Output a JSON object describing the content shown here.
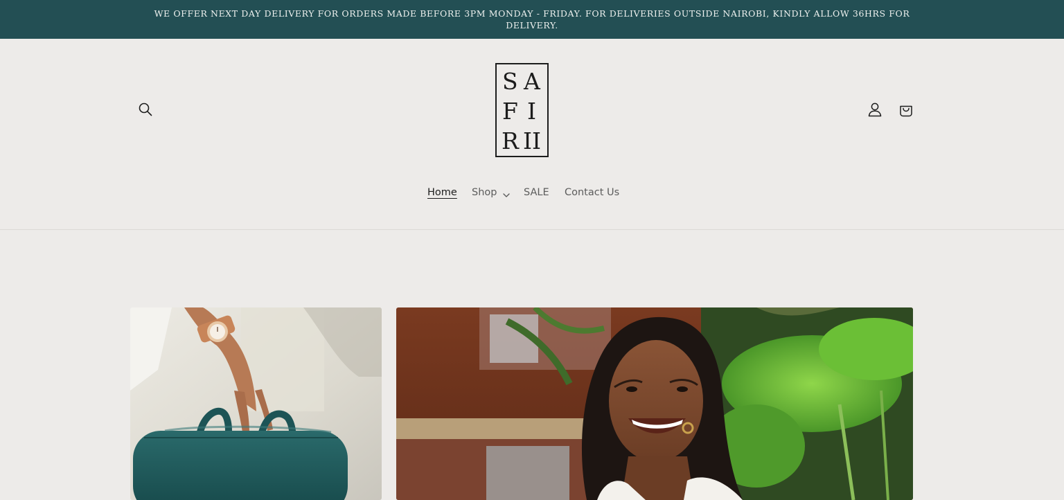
{
  "announcement": {
    "text": "WE OFFER NEXT DAY DELIVERY FOR ORDERS MADE BEFORE 3PM MONDAY - FRIDAY. FOR DELIVERIES OUTSIDE NAIROBI, KINDLY ALLOW 36HRS FOR DELIVERY."
  },
  "logo": {
    "letters": [
      "S",
      "A",
      "F",
      "I",
      "R",
      "II"
    ]
  },
  "nav": {
    "home": "Home",
    "shop": "Shop",
    "sale": "SALE",
    "contact": "Contact Us"
  },
  "icons": {
    "search": "search-icon",
    "account": "account-icon",
    "cart": "cart-icon",
    "shop_dropdown": "chevron-down-icon"
  },
  "colors": {
    "announcement_bg": "#234f54",
    "page_bg": "#edebe9",
    "bag_teal": "#1f5a5c"
  }
}
